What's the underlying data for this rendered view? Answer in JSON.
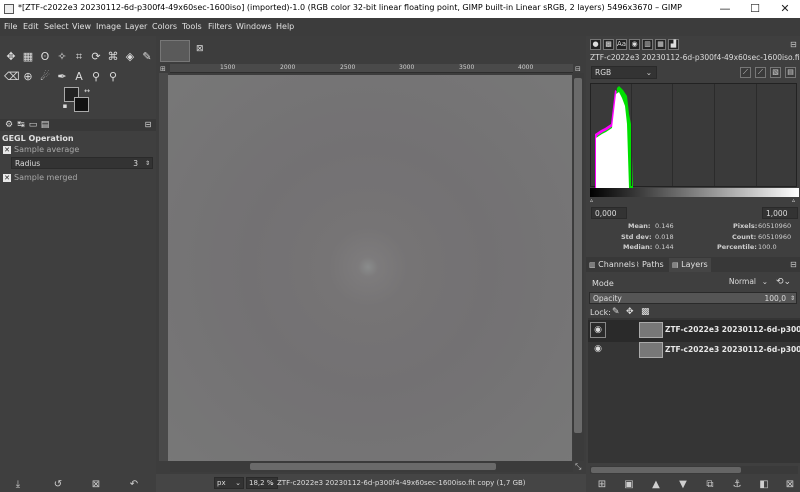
{
  "window": {
    "title": "*[ZTF-c2022e3 20230112-6d-p300f4-49x60sec-1600iso] (imported)-1.0 (RGB color 32-bit linear floating point, GIMP built-in Linear sRGB, 2 layers) 5496x3670 – GIMP",
    "minimize": "—",
    "maximize": "☐",
    "close": "✕"
  },
  "menu": [
    "File",
    "Edit",
    "Select",
    "View",
    "Image",
    "Layer",
    "Colors",
    "Tools",
    "Filters",
    "Windows",
    "Help"
  ],
  "tool_options": {
    "title": "GEGL Operation",
    "sample_average_label": "Sample average",
    "radius_label": "Radius",
    "radius_value": "3",
    "sample_merged_label": "Sample merged"
  },
  "ruler": {
    "top_ticks": [
      "1500",
      "2000",
      "2500",
      "3000",
      "3500",
      "4000"
    ]
  },
  "status": {
    "unit": "px",
    "zoom": "18,2 %",
    "info": "ZTF-c2022e3 20230112-6d-p300f4-49x60sec-1600iso.fit copy (1,7 GB)"
  },
  "histogram": {
    "channel": "RGB",
    "range_low": "0,000",
    "range_high": "1,000",
    "mean_label": "Mean:",
    "mean_value": "0.146",
    "std_label": "Std dev:",
    "std_value": "0.018",
    "median_label": "Median:",
    "median_value": "0.144",
    "pixels_label": "Pixels:",
    "pixels_value": "60510960",
    "count_label": "Count:",
    "count_value": "60510960",
    "percentile_label": "Percentile:",
    "percentile_value": "100.0"
  },
  "tabs": {
    "channels": "Channels",
    "paths": "Paths",
    "layers": "Layers"
  },
  "layers_panel": {
    "mode_label": "Mode",
    "mode_value": "Normal",
    "opacity_label": "Opacity",
    "opacity_value": "100,0",
    "lock_label": "Lock:",
    "layers": [
      {
        "name": "ZTF-c2022e3 20230112-6d-p300"
      },
      {
        "name": "ZTF-c2022e3 20230112-6d-p300"
      }
    ]
  },
  "colors": {
    "accent_green": "#00e000",
    "accent_magenta": "#ff00ff"
  }
}
